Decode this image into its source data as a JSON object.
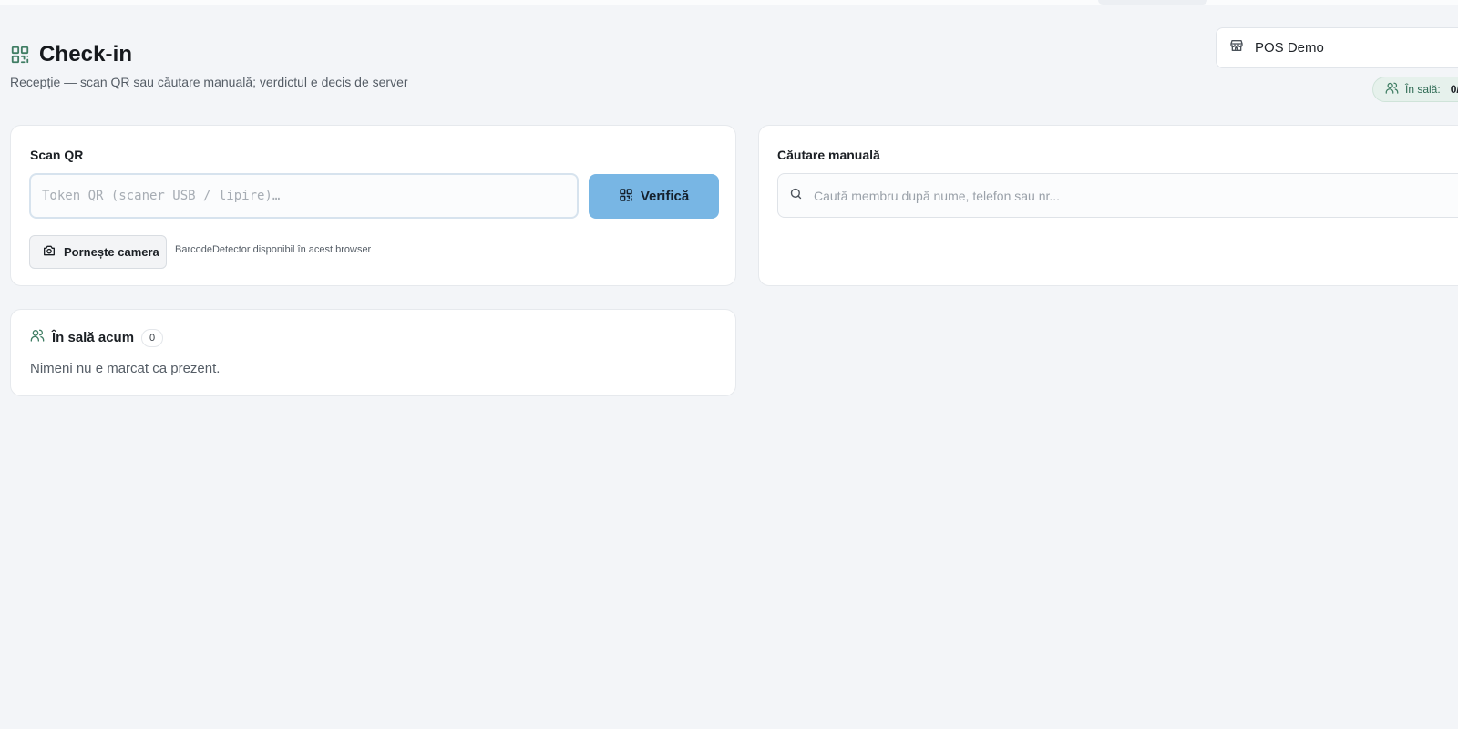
{
  "page": {
    "title": "Check-in",
    "subtitle": "Recepție — scan QR sau căutare manuală; verdictul e decis de server"
  },
  "location": {
    "selected": "POS Demo",
    "icon": "store-icon"
  },
  "occupancy": {
    "label": "În sală:",
    "value": "0/"
  },
  "scan_qr": {
    "title": "Scan QR",
    "input_placeholder": "Token QR (scaner USB / lipire)…",
    "input_value": "",
    "verify_label": "Verifică",
    "camera_label": "Pornește camera",
    "detector_note": "BarcodeDetector disponibil în acest browser"
  },
  "manual_search": {
    "title": "Căutare manuală",
    "placeholder": "Caută membru după nume, telefon sau nr..."
  },
  "present_now": {
    "title": "În sală acum",
    "count": "0",
    "empty_text": "Nimeni nu e marcat ca prezent."
  },
  "colors": {
    "accent_button": "#78b6e4",
    "icon_green": "#3f7d63",
    "background": "#f3f5f8"
  }
}
